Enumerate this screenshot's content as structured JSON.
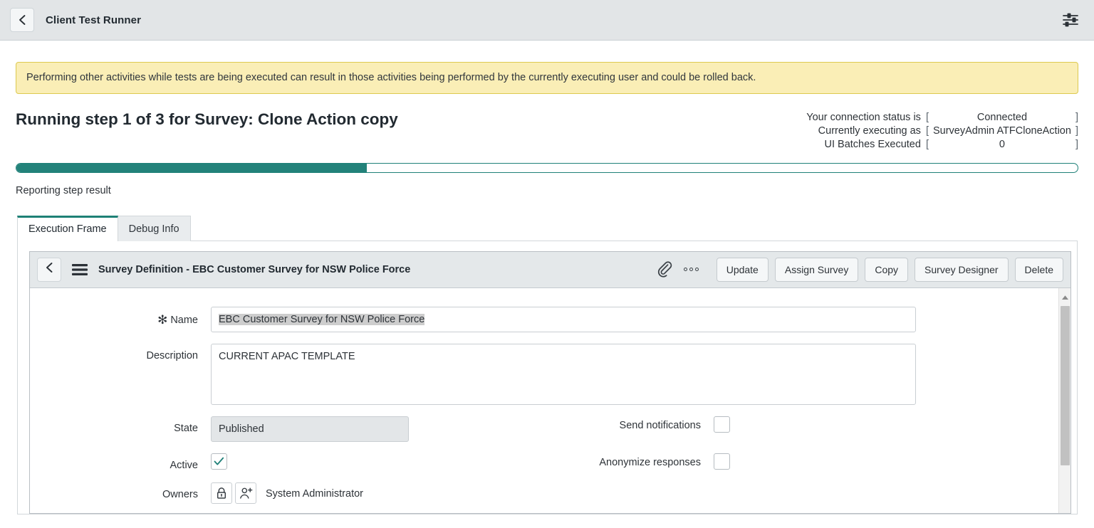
{
  "appbar": {
    "back_icon": "chevron-left-icon",
    "title": "Client Test Runner",
    "settings_icon": "sliders-settings-icon"
  },
  "banner": {
    "text": "Performing other activities while tests are being executed can result in those activities being performed by the currently executing user and could be rolled back."
  },
  "page": {
    "title": "Running step 1 of 3 for Survey: Clone Action copy",
    "sub_label": "Reporting step result"
  },
  "status": {
    "rows": [
      {
        "label": "Your connection status is",
        "value": "Connected"
      },
      {
        "label": "Currently executing as",
        "value": "SurveyAdmin ATFCloneAction"
      },
      {
        "label": "UI Batches Executed",
        "value": "0"
      }
    ],
    "bracket_open": "[",
    "bracket_close": "]"
  },
  "progress": {
    "percent": 33,
    "fill_color": "#23827a",
    "border_color": "#1f8078"
  },
  "tabs": [
    {
      "label": "Execution Frame",
      "active": true
    },
    {
      "label": "Debug Info",
      "active": false
    }
  ],
  "record_form": {
    "back_icon": "chevron-left-icon",
    "menu_icon": "hamburger-menu-icon",
    "title": "Survey Definition - EBC Customer Survey for NSW Police Force",
    "attachment_icon": "paperclip-icon",
    "more_icon": "more-options-icon",
    "buttons": [
      "Update",
      "Assign Survey",
      "Copy",
      "Survey Designer",
      "Delete"
    ],
    "fields": {
      "name": {
        "label": "Name",
        "required_marker": "✻",
        "value": "EBC Customer Survey for NSW Police Force",
        "selected": true
      },
      "description": {
        "label": "Description",
        "value": "CURRENT APAC TEMPLATE"
      },
      "state": {
        "label": "State",
        "value": "Published"
      },
      "active": {
        "label": "Active",
        "checked": true,
        "check_color": "#1f8078"
      },
      "owners": {
        "label": "Owners",
        "lock_icon": "padlock-icon",
        "add_user_icon": "add-user-icon",
        "value": "System Administrator"
      },
      "send_notifications": {
        "label": "Send notifications",
        "checked": false
      },
      "anonymize_responses": {
        "label": "Anonymize responses",
        "checked": false
      }
    },
    "scrollbar": {
      "up_arrow_icon": "scroll-up-arrow-icon"
    }
  }
}
